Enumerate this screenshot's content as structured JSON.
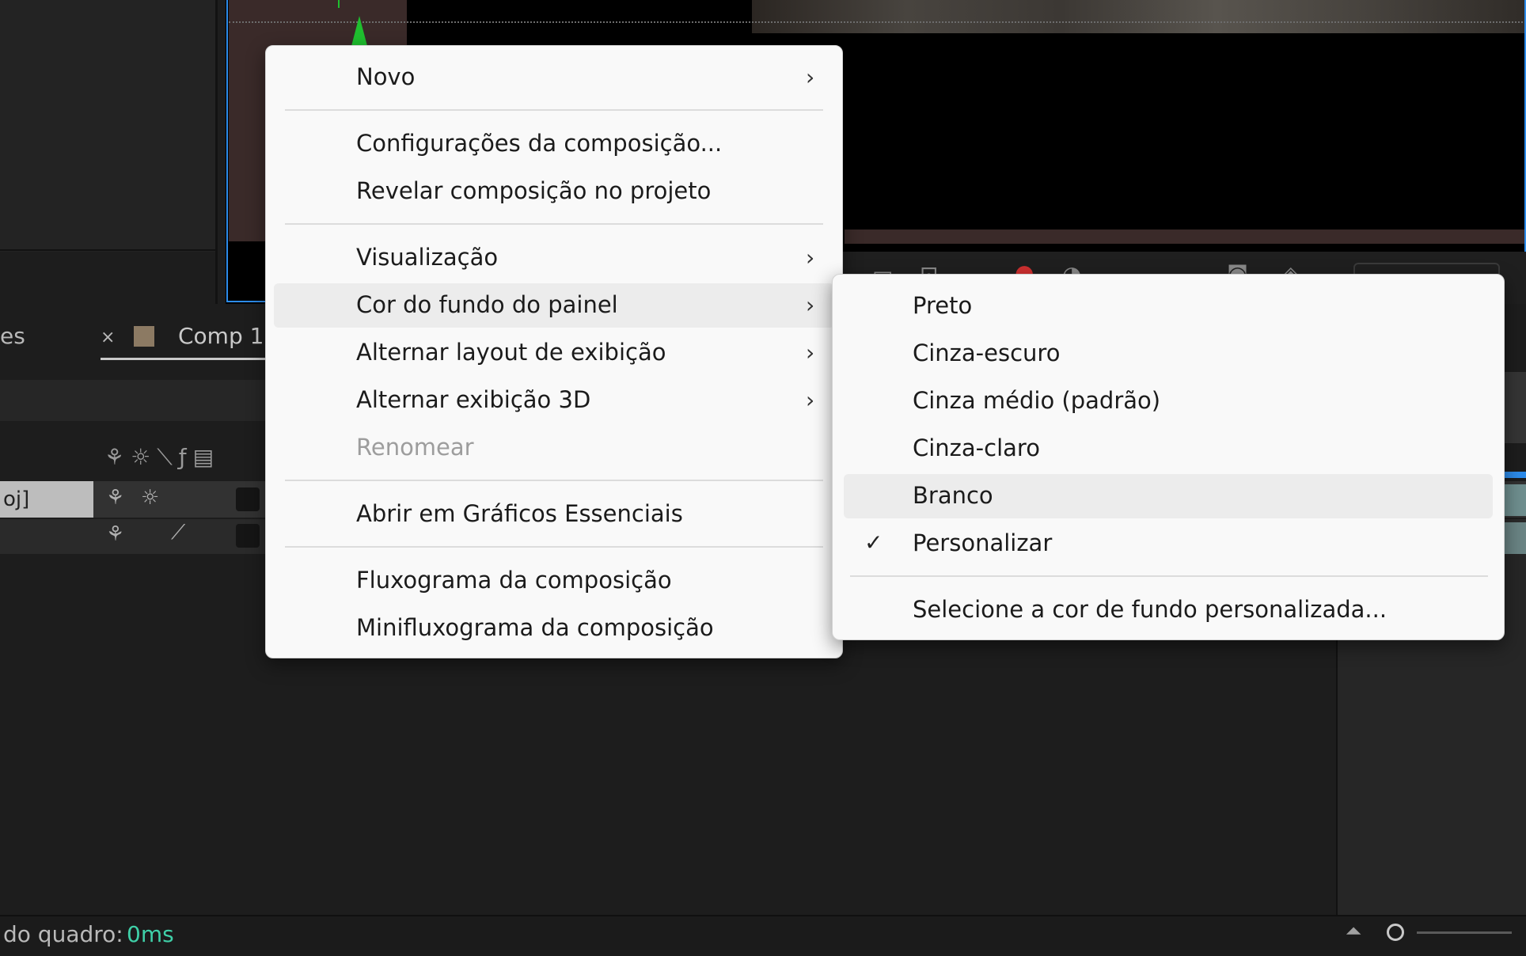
{
  "main_menu": {
    "items": [
      {
        "label": "Novo",
        "submenu": true
      },
      {
        "label": "Configurações da composição..."
      },
      {
        "label": "Revelar composição no projeto"
      },
      {
        "label": "Visualização",
        "submenu": true
      },
      {
        "label": "Cor do fundo do painel",
        "submenu": true,
        "highlighted": true
      },
      {
        "label": "Alternar layout de exibição",
        "submenu": true
      },
      {
        "label": "Alternar exibição 3D",
        "submenu": true
      },
      {
        "label": "Renomear",
        "disabled": true
      },
      {
        "label": "Abrir em Gráficos Essenciais"
      },
      {
        "label": "Fluxograma da composição"
      },
      {
        "label": "Minifluxograma da composição"
      }
    ]
  },
  "background_submenu": {
    "items": [
      {
        "label": "Preto"
      },
      {
        "label": "Cinza-escuro"
      },
      {
        "label": "Cinza médio (padrão)"
      },
      {
        "label": "Cinza-claro"
      },
      {
        "label": "Branco",
        "highlighted": true
      },
      {
        "label": "Personalizar",
        "checked": true
      },
      {
        "label": "Selecione a cor de fundo personalizada..."
      }
    ]
  },
  "timeline": {
    "tab_prev_label": "es",
    "tab_close": "×",
    "tab_label": "Comp 1",
    "tab_swatch_color": "#8c7a63",
    "layer1_name_fragment": "oj]"
  },
  "status_bar": {
    "label": "do quadro:",
    "value": "0ms",
    "value_color": "#3fd0a8"
  },
  "icons": {
    "submenu_arrow": "›",
    "check": "✓"
  }
}
